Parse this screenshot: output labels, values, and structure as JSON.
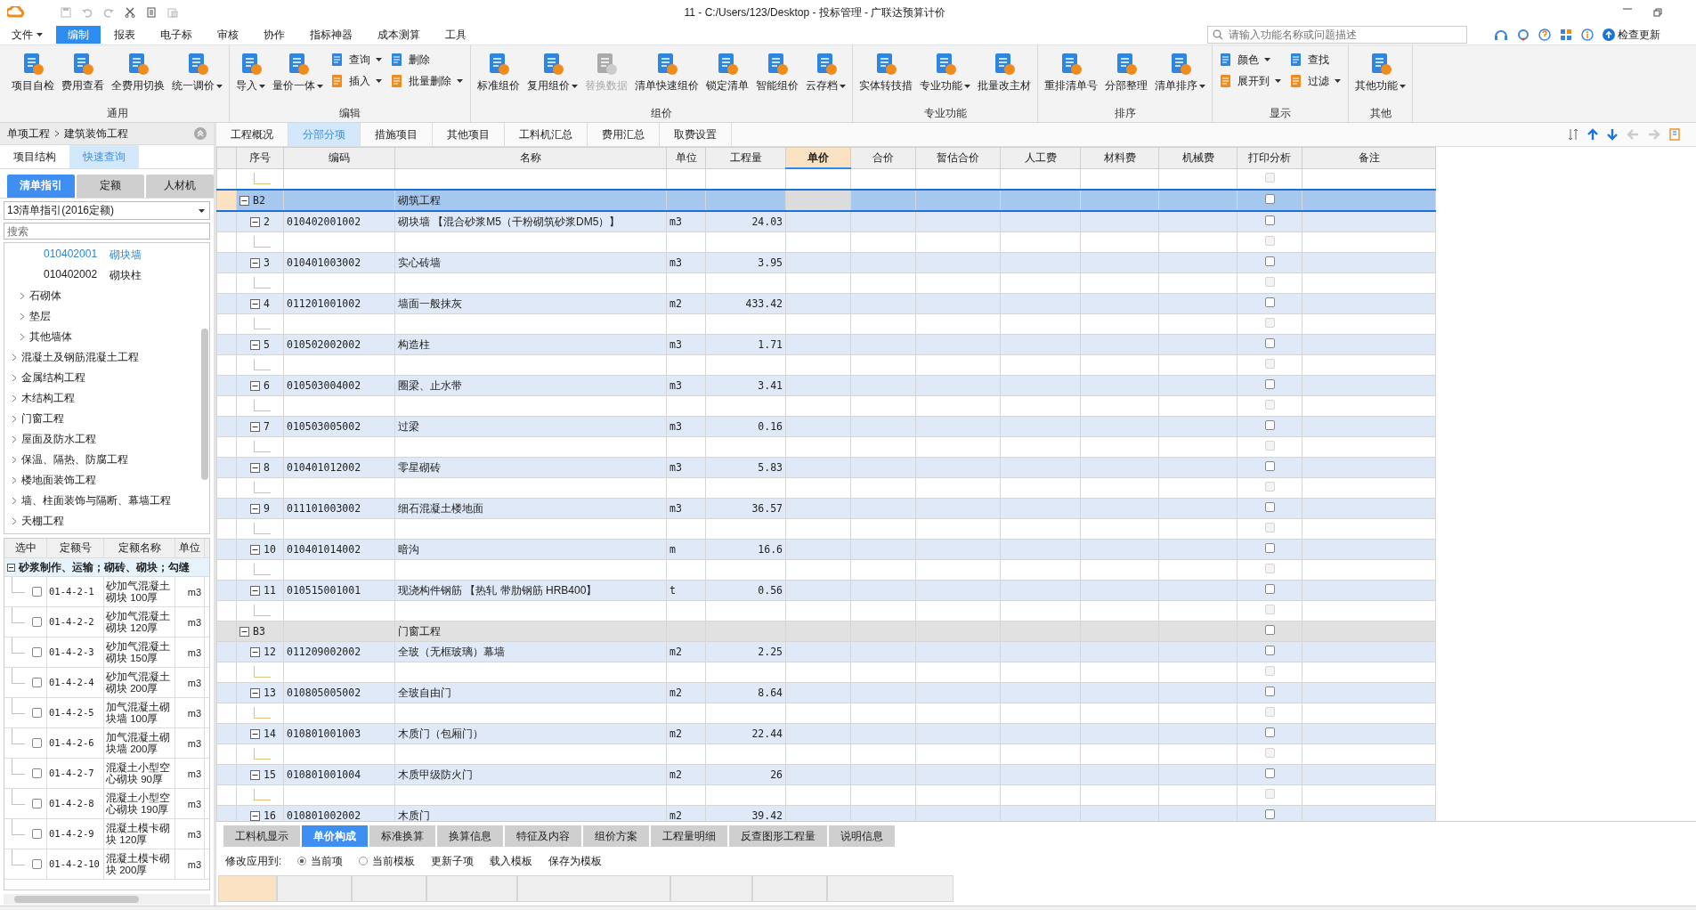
{
  "window": {
    "title": "11 - C:/Users/123/Desktop - 投标管理 - 广联达预算计价",
    "update_label": "检查更新"
  },
  "menu": [
    {
      "label": "文件",
      "dropdown": true,
      "selected": false
    },
    {
      "label": "编制",
      "dropdown": false,
      "selected": true
    },
    {
      "label": "报表",
      "dropdown": false,
      "selected": false
    },
    {
      "label": "电子标",
      "dropdown": false,
      "selected": false
    },
    {
      "label": "审核",
      "dropdown": false,
      "selected": false
    },
    {
      "label": "协作",
      "dropdown": false,
      "selected": false
    },
    {
      "label": "指标神器",
      "dropdown": false,
      "selected": false
    },
    {
      "label": "成本测算",
      "dropdown": false,
      "selected": false
    },
    {
      "label": "工具",
      "dropdown": false,
      "selected": false
    }
  ],
  "search": {
    "placeholder": "请输入功能名称或问题描述"
  },
  "ribbon": [
    {
      "label": "通用",
      "buttons": [
        {
          "kind": "large",
          "label": "项目自检",
          "dropdown": false,
          "disabled": false
        },
        {
          "kind": "large",
          "label": "费用查看",
          "dropdown": false,
          "disabled": false
        },
        {
          "kind": "large",
          "label": "全费用切换",
          "dropdown": false,
          "disabled": false
        },
        {
          "kind": "large",
          "label": "统一调价",
          "dropdown": true,
          "disabled": false
        }
      ]
    },
    {
      "label": "编辑",
      "buttons": [
        {
          "kind": "large",
          "label": "导入",
          "dropdown": true,
          "disabled": false
        },
        {
          "kind": "large",
          "label": "量价一体",
          "dropdown": true,
          "disabled": false
        },
        {
          "kind": "small",
          "label": "查询",
          "dropdown": true,
          "disabled": false
        },
        {
          "kind": "small",
          "label": "插入",
          "dropdown": true,
          "disabled": false
        },
        {
          "kind": "small",
          "label": "删除",
          "dropdown": false,
          "disabled": false
        },
        {
          "kind": "small",
          "label": "批量删除",
          "dropdown": true,
          "disabled": false
        }
      ]
    },
    {
      "label": "组价",
      "buttons": [
        {
          "kind": "large",
          "label": "标准组价",
          "dropdown": false,
          "disabled": false
        },
        {
          "kind": "large",
          "label": "复用组价",
          "dropdown": true,
          "disabled": false
        },
        {
          "kind": "large",
          "label": "替换数据",
          "dropdown": false,
          "disabled": true
        },
        {
          "kind": "large",
          "label": "清单快速组价",
          "dropdown": false,
          "disabled": false
        },
        {
          "kind": "large",
          "label": "锁定清单",
          "dropdown": false,
          "disabled": false
        },
        {
          "kind": "large",
          "label": "智能组价",
          "dropdown": false,
          "disabled": false
        },
        {
          "kind": "large",
          "label": "云存档",
          "dropdown": true,
          "disabled": false
        }
      ]
    },
    {
      "label": "专业功能",
      "buttons": [
        {
          "kind": "large",
          "label": "实体转技措",
          "dropdown": false,
          "disabled": false
        },
        {
          "kind": "large",
          "label": "专业功能",
          "dropdown": true,
          "disabled": false
        },
        {
          "kind": "large",
          "label": "批量改主材",
          "dropdown": false,
          "disabled": false
        }
      ]
    },
    {
      "label": "排序",
      "buttons": [
        {
          "kind": "large",
          "label": "重排清单号",
          "dropdown": false,
          "disabled": false
        },
        {
          "kind": "large",
          "label": "分部整理",
          "dropdown": false,
          "disabled": false
        },
        {
          "kind": "large",
          "label": "清单排序",
          "dropdown": true,
          "disabled": false
        }
      ]
    },
    {
      "label": "显示",
      "buttons": [
        {
          "kind": "small",
          "label": "颜色",
          "dropdown": true,
          "disabled": false
        },
        {
          "kind": "small",
          "label": "展开到",
          "dropdown": true,
          "disabled": false
        },
        {
          "kind": "small",
          "label": "查找",
          "dropdown": false,
          "disabled": false
        },
        {
          "kind": "small",
          "label": "过滤",
          "dropdown": true,
          "disabled": false
        }
      ]
    },
    {
      "label": "其他",
      "buttons": [
        {
          "kind": "large",
          "label": "其他功能",
          "dropdown": true,
          "disabled": false
        }
      ]
    }
  ],
  "left_panel": {
    "breadcrumb": [
      "单项工程",
      "建筑装饰工程"
    ],
    "tabs": [
      {
        "label": "项目结构",
        "selected": false
      },
      {
        "label": "快速查询",
        "selected": true
      }
    ],
    "subtabs": [
      {
        "label": "清单指引",
        "selected": true
      },
      {
        "label": "定额",
        "selected": false
      },
      {
        "label": "人材机",
        "selected": false
      }
    ],
    "library": "13清单指引(2016定额)",
    "search": {
      "placeholder": "搜索"
    },
    "tree": [
      {
        "children": [
          {
            "children": [
              {
                "code": "010402001",
                "label": "砌块墙",
                "selected": true
              },
              {
                "code": "010402002",
                "label": "砌块柱",
                "selected": false
              }
            ]
          },
          {
            "label": "石砌体",
            "expanded": false
          },
          {
            "label": "垫层",
            "expanded": false
          },
          {
            "label": "其他墙体",
            "expanded": false
          }
        ]
      },
      {
        "label": "混凝土及钢筋混凝土工程",
        "expanded": false
      },
      {
        "label": "金属结构工程",
        "expanded": false
      },
      {
        "label": "木结构工程",
        "expanded": false
      },
      {
        "label": "门窗工程",
        "expanded": false
      },
      {
        "label": "屋面及防水工程",
        "expanded": false
      },
      {
        "label": "保温、隔热、防腐工程",
        "expanded": false
      },
      {
        "label": "楼地面装饰工程",
        "expanded": false
      },
      {
        "label": "墙、柱面装饰与隔断、幕墙工程",
        "expanded": false
      },
      {
        "label": "天棚工程",
        "expanded": false
      }
    ],
    "quota_columns": [
      "选中",
      "定额号",
      "定额名称",
      "单位"
    ],
    "quota_group": {
      "label": "砂浆制作、运输；砌砖、砌块；勾缝",
      "expanded": true
    },
    "quota_rows": [
      {
        "checked": false,
        "code": "01-4-2-1",
        "name": "砂加气混凝土砌块 100厚",
        "unit": "m3"
      },
      {
        "checked": false,
        "code": "01-4-2-2",
        "name": "砂加气混凝土砌块 120厚",
        "unit": "m3"
      },
      {
        "checked": false,
        "code": "01-4-2-3",
        "name": "砂加气混凝土砌块 150厚",
        "unit": "m3"
      },
      {
        "checked": false,
        "code": "01-4-2-4",
        "name": "砂加气混凝土砌块 200厚",
        "unit": "m3"
      },
      {
        "checked": false,
        "code": "01-4-2-5",
        "name": "加气混凝土砌块墙 100厚",
        "unit": "m3"
      },
      {
        "checked": false,
        "code": "01-4-2-6",
        "name": "加气混凝土砌块墙 200厚",
        "unit": "m3"
      },
      {
        "checked": false,
        "code": "01-4-2-7",
        "name": "混凝土小型空心砌块 90厚",
        "unit": "m3"
      },
      {
        "checked": false,
        "code": "01-4-2-8",
        "name": "混凝土小型空心砌块 190厚",
        "unit": "m3"
      },
      {
        "checked": false,
        "code": "01-4-2-9",
        "name": "混凝土模卡砌块 120厚",
        "unit": "m3"
      },
      {
        "checked": false,
        "code": "01-4-2-10",
        "name": "混凝土模卡砌块 200厚",
        "unit": "m3"
      }
    ]
  },
  "main_tabs": [
    {
      "label": "工程概况",
      "selected": false
    },
    {
      "label": "分部分项",
      "selected": true
    },
    {
      "label": "措施项目",
      "selected": false
    },
    {
      "label": "其他项目",
      "selected": false
    },
    {
      "label": "工料机汇总",
      "selected": false
    },
    {
      "label": "费用汇总",
      "selected": false
    },
    {
      "label": "取费设置",
      "selected": false
    }
  ],
  "table": {
    "columns": [
      {
        "label": "序号",
        "selected": false
      },
      {
        "label": "编码",
        "selected": false
      },
      {
        "label": "名称",
        "selected": false
      },
      {
        "label": "单位",
        "selected": false
      },
      {
        "label": "工程量",
        "selected": false
      },
      {
        "label": "单价",
        "selected": true
      },
      {
        "label": "合价",
        "selected": false
      },
      {
        "label": "暂估合价",
        "selected": false
      },
      {
        "label": "人工费",
        "selected": false
      },
      {
        "label": "材料费",
        "selected": false
      },
      {
        "label": "机械费",
        "selected": false
      },
      {
        "label": "打印分析",
        "selected": false
      },
      {
        "label": "备注",
        "selected": false
      }
    ],
    "rows": [
      {
        "kind": "sub",
        "disabled": true
      },
      {
        "kind": "section",
        "code": "B2",
        "name": "砌筑工程",
        "expanded": true,
        "selected": true,
        "print_analysis": false,
        "children": [
          {
            "kind": "item",
            "number": "2",
            "code": "010402001002",
            "name": "砌块墙 【混合砂浆M5（干粉砌筑砂浆DM5）】",
            "unit": "m3",
            "quantity": "24.03",
            "expanded": true,
            "print_analysis": false,
            "children": [
              {
                "kind": "sub",
                "disabled": true
              }
            ]
          },
          {
            "kind": "item",
            "number": "3",
            "code": "010401003002",
            "name": "实心砖墙",
            "unit": "m3",
            "quantity": "3.95",
            "expanded": true,
            "print_analysis": false,
            "children": [
              {
                "kind": "sub",
                "disabled": true
              }
            ]
          },
          {
            "kind": "item",
            "number": "4",
            "code": "011201001002",
            "name": "墙面一般抹灰",
            "unit": "m2",
            "quantity": "433.42",
            "expanded": true,
            "print_analysis": false,
            "children": [
              {
                "kind": "sub",
                "disabled": true
              }
            ]
          },
          {
            "kind": "item",
            "number": "5",
            "code": "010502002002",
            "name": "构造柱",
            "unit": "m3",
            "quantity": "1.71",
            "expanded": true,
            "print_analysis": false,
            "children": [
              {
                "kind": "sub",
                "disabled": true
              }
            ]
          },
          {
            "kind": "item",
            "number": "6",
            "code": "010503004002",
            "name": "圈梁、止水带",
            "unit": "m3",
            "quantity": "3.41",
            "expanded": true,
            "print_analysis": false,
            "children": [
              {
                "kind": "sub",
                "disabled": true
              }
            ]
          },
          {
            "kind": "item",
            "number": "7",
            "code": "010503005002",
            "name": "过梁",
            "unit": "m3",
            "quantity": "0.16",
            "expanded": true,
            "print_analysis": false,
            "children": [
              {
                "kind": "sub",
                "disabled": true
              }
            ]
          },
          {
            "kind": "item",
            "number": "8",
            "code": "010401012002",
            "name": "零星砌砖",
            "unit": "m3",
            "quantity": "5.83",
            "expanded": true,
            "print_analysis": false,
            "children": [
              {
                "kind": "sub",
                "disabled": true
              }
            ]
          },
          {
            "kind": "item",
            "number": "9",
            "code": "011101003002",
            "name": "细石混凝土楼地面",
            "unit": "m3",
            "quantity": "36.57",
            "expanded": true,
            "print_analysis": false,
            "children": [
              {
                "kind": "sub",
                "disabled": true
              }
            ]
          },
          {
            "kind": "item",
            "number": "10",
            "code": "010401014002",
            "name": "暗沟",
            "unit": "m",
            "quantity": "16.6",
            "expanded": true,
            "print_analysis": false,
            "children": [
              {
                "kind": "sub",
                "disabled": true
              }
            ]
          },
          {
            "kind": "item",
            "number": "11",
            "code": "010515001001",
            "name": "现浇构件钢筋 【热轧 带肋钢筋 HRB400】",
            "unit": "t",
            "quantity": "0.56",
            "expanded": true,
            "print_analysis": false,
            "children": [
              {
                "kind": "sub",
                "disabled": true
              }
            ]
          }
        ]
      },
      {
        "kind": "section",
        "code": "B3",
        "name": "门窗工程",
        "expanded": true,
        "selected": false,
        "print_analysis": false,
        "children": [
          {
            "kind": "item",
            "number": "12",
            "code": "011209002002",
            "name": "全玻（无框玻璃）幕墙",
            "unit": "m2",
            "quantity": "2.25",
            "expanded": true,
            "print_analysis": false,
            "children": [
              {
                "kind": "sub",
                "disabled": true
              }
            ]
          },
          {
            "kind": "item",
            "number": "13",
            "code": "010805005002",
            "name": "全玻自由门",
            "unit": "m2",
            "quantity": "8.64",
            "expanded": true,
            "print_analysis": false,
            "children": [
              {
                "kind": "sub",
                "disabled": true
              }
            ]
          },
          {
            "kind": "item",
            "number": "14",
            "code": "010801001003",
            "name": "木质门（包厢门）",
            "unit": "m2",
            "quantity": "22.44",
            "expanded": true,
            "print_analysis": false,
            "children": [
              {
                "kind": "sub",
                "disabled": true
              }
            ]
          },
          {
            "kind": "item",
            "number": "15",
            "code": "010801001004",
            "name": "木质甲级防火门",
            "unit": "m2",
            "quantity": "26",
            "expanded": true,
            "print_analysis": false,
            "children": [
              {
                "kind": "sub",
                "disabled": true
              }
            ]
          },
          {
            "kind": "item",
            "number": "16",
            "code": "010801002002",
            "name": "木质门",
            "unit": "m2",
            "quantity": "39.42",
            "expanded": true,
            "print_analysis": false
          }
        ]
      }
    ]
  },
  "bottom_tabs": [
    {
      "label": "工料机显示",
      "selected": false
    },
    {
      "label": "单价构成",
      "selected": true
    },
    {
      "label": "标准换算",
      "selected": false
    },
    {
      "label": "换算信息",
      "selected": false
    },
    {
      "label": "特征及内容",
      "selected": false
    },
    {
      "label": "组价方案",
      "selected": false
    },
    {
      "label": "工程量明细",
      "selected": false
    },
    {
      "label": "反查图形工程量",
      "selected": false
    },
    {
      "label": "说明信息",
      "selected": false
    }
  ],
  "apply_to": {
    "label": "修改应用到:",
    "options": [
      {
        "label": "当前项",
        "selected": true
      },
      {
        "label": "当前模板",
        "selected": false
      }
    ]
  },
  "bottom_actions": [
    "更新子项",
    "载入模板",
    "保存为模板"
  ]
}
